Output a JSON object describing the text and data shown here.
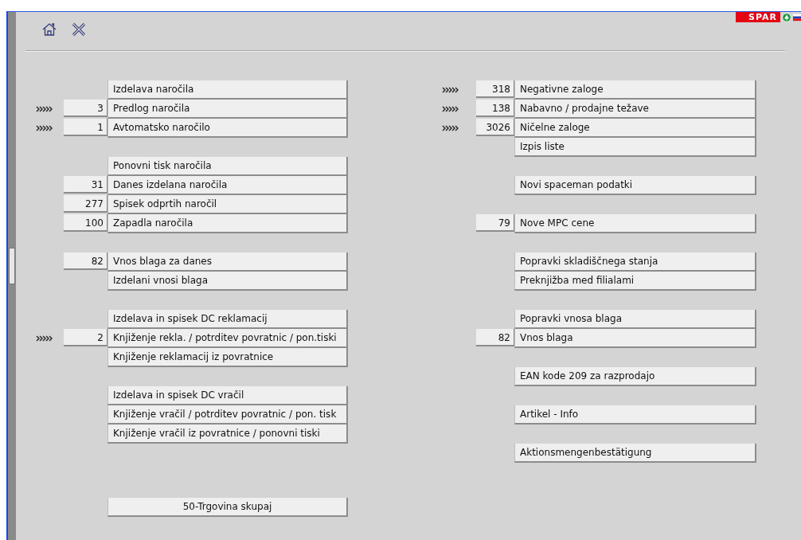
{
  "header": {
    "logo_text": "SPAR"
  },
  "columns": [
    {
      "groups": [
        {
          "kind": "list",
          "items": [
            {
              "label": "Izdelava naročila",
              "flagged": false
            },
            {
              "label": "Predlog naročila",
              "count": "3",
              "flagged": true
            },
            {
              "label": "Avtomatsko naročilo",
              "count": "1",
              "flagged": true
            }
          ]
        },
        {
          "kind": "list",
          "items": [
            {
              "label": "Ponovni tisk naročila",
              "flagged": false
            },
            {
              "label": "Danes izdelana naročila",
              "count": "31",
              "flagged": false
            },
            {
              "label": "Spisek odprtih naročil",
              "count": "277",
              "flagged": false
            },
            {
              "label": "Zapadla naročila",
              "count": "100",
              "flagged": false
            }
          ]
        },
        {
          "kind": "list",
          "items": [
            {
              "label": "Vnos blaga za danes",
              "count": "82",
              "flagged": false
            },
            {
              "label": "Izdelani vnosi blaga",
              "flagged": false
            }
          ]
        },
        {
          "kind": "list",
          "items": [
            {
              "label": "Izdelava in spisek DC reklamacij",
              "flagged": false
            },
            {
              "label": "Knjiženje rekla. / potrditev povratnic / pon.tiski",
              "count": "2",
              "flagged": true
            },
            {
              "label": "Knjiženje reklamacij iz povratnice",
              "flagged": false
            }
          ]
        },
        {
          "kind": "list",
          "items": [
            {
              "label": "Izdelava in spisek DC vračil",
              "flagged": false
            },
            {
              "label": "Knjiženje vračil / potrditev povratnic / pon. tisk",
              "flagged": false
            },
            {
              "label": "Knjiženje vračil iz povratnice / ponovni tiski",
              "flagged": false
            }
          ]
        },
        {
          "kind": "footer",
          "items": [
            {
              "label": "50-Trgovina skupaj",
              "flagged": false
            }
          ]
        }
      ]
    },
    {
      "groups": [
        {
          "kind": "list",
          "items": [
            {
              "label": "Negativne zaloge",
              "count": "318",
              "flagged": true
            },
            {
              "label": "Nabavno / prodajne težave",
              "count": "138",
              "flagged": true
            },
            {
              "label": "Ničelne zaloge",
              "count": "3026",
              "flagged": true
            },
            {
              "label": "Izpis liste",
              "flagged": false
            }
          ]
        },
        {
          "kind": "list",
          "items": [
            {
              "label": "Novi spaceman podatki",
              "flagged": false
            }
          ]
        },
        {
          "kind": "list",
          "items": [
            {
              "label": "Nove MPC cene",
              "count": "79",
              "flagged": false
            }
          ]
        },
        {
          "kind": "list",
          "items": [
            {
              "label": "Popravki skladiščnega stanja",
              "flagged": false
            },
            {
              "label": "Preknjižba med filialami",
              "flagged": false
            }
          ]
        },
        {
          "kind": "list",
          "items": [
            {
              "label": "Popravki vnosa blaga",
              "flagged": false
            },
            {
              "label": "Vnos blaga",
              "count": "82",
              "flagged": false
            }
          ]
        },
        {
          "kind": "list",
          "items": [
            {
              "label": "EAN kode 209 za razprodajo",
              "flagged": false
            }
          ]
        },
        {
          "kind": "list",
          "items": [
            {
              "label": "Artikel - Info",
              "flagged": false
            }
          ]
        },
        {
          "kind": "list",
          "items": [
            {
              "label": "Aktionsmengenbestätigung",
              "flagged": false
            }
          ]
        }
      ]
    }
  ]
}
